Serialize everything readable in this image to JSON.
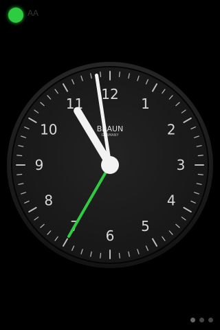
{
  "status": {
    "indicator_color": "#2ecc40",
    "label": "AA"
  },
  "clock": {
    "brand": "BRAUN",
    "country": "GERMANY",
    "time": {
      "hour": 10,
      "minute": 58,
      "second": 35
    },
    "numerals": [
      "12",
      "1",
      "2",
      "3",
      "4",
      "5",
      "6",
      "7",
      "8",
      "9",
      "10",
      "11"
    ],
    "colors": {
      "face": "#1b1b1b",
      "bezel": "#2a2a2a",
      "text": "#d8d8d8",
      "hands": "#f2f2f2",
      "second_hand": "#2ecc40"
    }
  },
  "pager": {
    "count": 3,
    "active": 0
  }
}
